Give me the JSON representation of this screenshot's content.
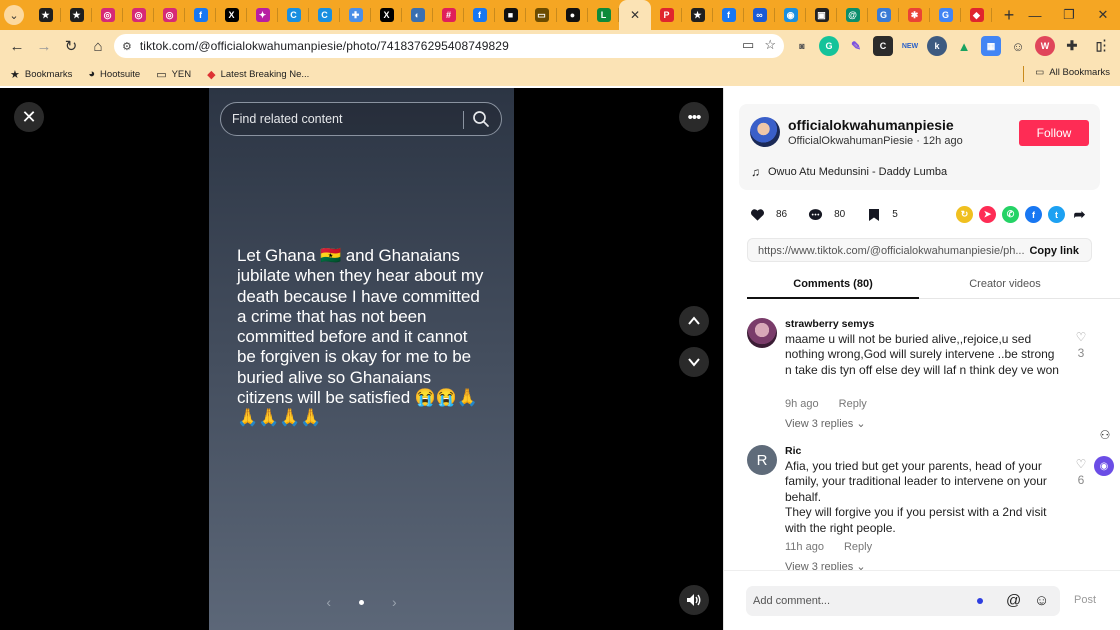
{
  "browser": {
    "url": "tiktok.com/@officialokwahumanpiesie/photo/7418376295408749829",
    "tabs": [
      {
        "icon": "star-icon",
        "color": "#1f1f1f",
        "glyph": "★"
      },
      {
        "icon": "star-icon",
        "color": "#1f1f1f",
        "glyph": "★"
      },
      {
        "icon": "instagram-icon",
        "color": "#d62976",
        "glyph": "◎"
      },
      {
        "icon": "instagram-icon",
        "color": "#d62976",
        "glyph": "◎"
      },
      {
        "icon": "instagram-icon",
        "color": "#d62976",
        "glyph": "◎"
      },
      {
        "icon": "facebook-icon",
        "color": "#1877f2",
        "glyph": "f"
      },
      {
        "icon": "x-icon",
        "color": "#000000",
        "glyph": "X"
      },
      {
        "icon": "star-icon",
        "color": "#b81ea3",
        "glyph": "✦"
      },
      {
        "icon": "c-icon",
        "color": "#1a8fe0",
        "glyph": "C"
      },
      {
        "icon": "c-icon",
        "color": "#1a8fe0",
        "glyph": "C"
      },
      {
        "icon": "puzzle-icon",
        "color": "#4a8fe7",
        "glyph": "✚"
      },
      {
        "icon": "x-icon",
        "color": "#000000",
        "glyph": "X"
      },
      {
        "icon": "circle-icon",
        "color": "#3a6fb0",
        "glyph": "◐"
      },
      {
        "icon": "slack-icon",
        "color": "#e01e5a",
        "glyph": "#"
      },
      {
        "icon": "facebook-icon",
        "color": "#1877f2",
        "glyph": "f"
      },
      {
        "icon": "square-icon",
        "color": "#111111",
        "glyph": "■"
      },
      {
        "icon": "card-icon",
        "color": "#6b4b00",
        "glyph": "▭"
      },
      {
        "icon": "circle-icon",
        "color": "#111111",
        "glyph": "●"
      },
      {
        "icon": "letter-l-icon",
        "color": "#0f8a3a",
        "glyph": "L"
      }
    ],
    "active_tab": {
      "icon": "tiktok-icon",
      "color": "#000000",
      "glyph": "♪"
    },
    "tabs_after": [
      {
        "icon": "pin-icon",
        "color": "#e0252d",
        "glyph": "P"
      },
      {
        "icon": "star-icon",
        "color": "#1f1f1f",
        "glyph": "★"
      },
      {
        "icon": "facebook-icon",
        "color": "#1877f2",
        "glyph": "f"
      },
      {
        "icon": "meta-icon",
        "color": "#1a5bd6",
        "glyph": "∞"
      },
      {
        "icon": "chat-icon",
        "color": "#1a8fe0",
        "glyph": "◉"
      },
      {
        "icon": "chat-icon",
        "color": "#222222",
        "glyph": "▣"
      },
      {
        "icon": "at-icon",
        "color": "#0b8e6c",
        "glyph": "@"
      },
      {
        "icon": "go-icon",
        "color": "#3a7bd5",
        "glyph": "G"
      },
      {
        "icon": "star-icon",
        "color": "#ea4335",
        "glyph": "✱"
      },
      {
        "icon": "google-icon",
        "color": "#4285f4",
        "glyph": "G"
      },
      {
        "icon": "shield-icon",
        "color": "#e0252d",
        "glyph": "◆"
      }
    ],
    "new_tab": "+",
    "bookmarks": [
      {
        "label": "Bookmarks",
        "icon": "star-icon",
        "glyph": "★"
      },
      {
        "label": "Hootsuite",
        "icon": "owl-icon",
        "glyph": "◕"
      },
      {
        "label": "YEN",
        "icon": "folder-icon",
        "glyph": "▭"
      },
      {
        "label": "Latest Breaking Ne...",
        "icon": "news-icon",
        "glyph": "◆"
      }
    ],
    "all_bookmarks": "All Bookmarks"
  },
  "viewer": {
    "search_placeholder": "Find related content",
    "post_text": "Let Ghana 🇬🇭 and Ghanaians jubilate when they hear about my death because I have committed a crime that has not been committed before and it cannot be forgiven is okay for me to be buried alive so Ghanaians citizens will be satisfied 😭😭🙏🙏🙏🙏🙏"
  },
  "author": {
    "username": "officialokwahumanpiesie",
    "display_name": "OfficialOkwahumanPiesie",
    "time_ago": "12h ago",
    "follow_label": "Follow",
    "music": "Owuo Atu Medunsini - Daddy Lumba"
  },
  "stats": {
    "likes": "86",
    "comments": "80",
    "saves": "5"
  },
  "share_link": {
    "url": "https://www.tiktok.com/@officialokwahumanpiesie/ph...",
    "copy_label": "Copy link"
  },
  "tabs": {
    "comments": "Comments (80)",
    "creator": "Creator videos"
  },
  "comments": [
    {
      "user": "strawberry semys",
      "text": "maame u will not be buried alive,,rejoice,u sed nothing wrong,God will surely intervene ..be strong n take dis tyn off else dey will laf n think dey ve won",
      "time": "9h ago",
      "reply": "Reply",
      "replies": "View 3 replies",
      "likes": "3",
      "avatar_color": "#c9a0c8"
    },
    {
      "user": "Ric",
      "avatar_letter": "R",
      "text": "Afia, you tried but get your parents, head of your family, your traditional leader to intervene on your behalf.\nThey will forgive you if you persist with a 2nd visit with the right people.",
      "time": "11h ago",
      "reply": "Reply",
      "replies": "View 3 replies",
      "likes": "6",
      "avatar_color": "#5f6b7a"
    }
  ],
  "composer": {
    "placeholder": "Add comment...",
    "post_label": "Post"
  },
  "colors": {
    "accent": "#fe2c55",
    "browser_frame": "#f5a623"
  }
}
